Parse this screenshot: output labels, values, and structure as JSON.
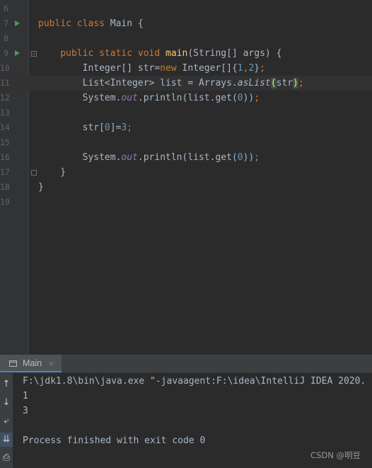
{
  "editor": {
    "lines": [
      {
        "n": "6",
        "code": ""
      },
      {
        "n": "7",
        "code": "public class Main {"
      },
      {
        "n": "8",
        "code": ""
      },
      {
        "n": "9",
        "code": "    public static void main(String[] args) {"
      },
      {
        "n": "10",
        "code": "        Integer[] str=new Integer[]{1,2};"
      },
      {
        "n": "11",
        "code": "        List<Integer> list = Arrays.asList(str);"
      },
      {
        "n": "12",
        "code": "        System.out.println(list.get(0));"
      },
      {
        "n": "13",
        "code": ""
      },
      {
        "n": "14",
        "code": "        str[0]=3;"
      },
      {
        "n": "15",
        "code": ""
      },
      {
        "n": "16",
        "code": "        System.out.println(list.get(0));"
      },
      {
        "n": "17",
        "code": "    }"
      },
      {
        "n": "18",
        "code": "}"
      },
      {
        "n": "19",
        "code": ""
      }
    ]
  },
  "run_panel": {
    "tab_label": "Main",
    "tab_close": "×",
    "toolbar_icons": [
      "up-arrow-icon",
      "down-arrow-icon",
      "soft-wrap-icon",
      "scroll-to-end-icon",
      "print-icon"
    ],
    "output": [
      "F:\\jdk1.8\\bin\\java.exe \"-javaagent:F:\\idea\\IntelliJ IDEA 2020.",
      "1",
      "3",
      "",
      "Process finished with exit code 0"
    ]
  },
  "watermark": "CSDN @明豆",
  "colors": {
    "keyword": "#cc7832",
    "method": "#ffc66d",
    "number": "#6897bb",
    "static_field": "#9876aa",
    "text": "#a9b7c6",
    "run_icon": "#499c54"
  }
}
